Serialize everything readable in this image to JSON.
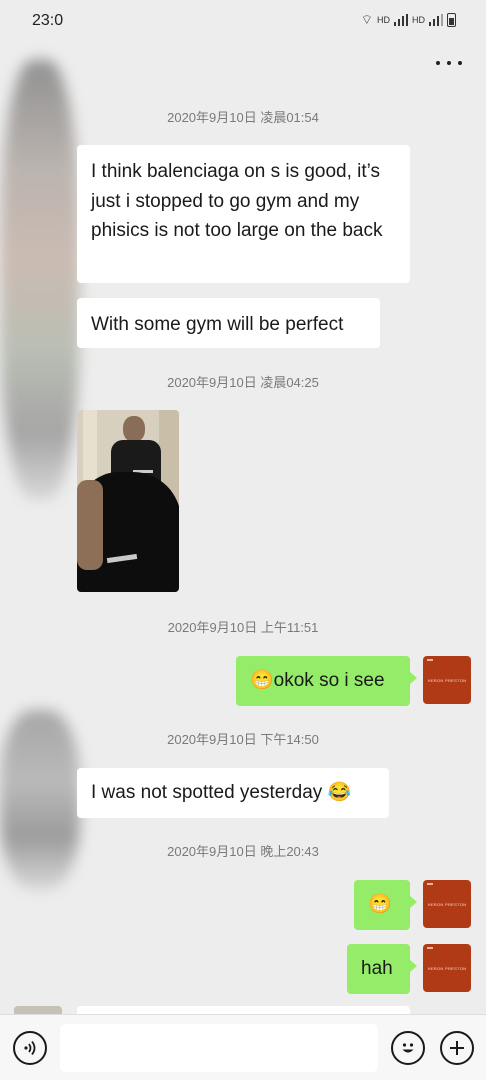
{
  "status_bar": {
    "time": "23:0",
    "network1": "HD",
    "network2": "HD"
  },
  "header": {
    "more_icon": "more-dots-icon"
  },
  "messages": {
    "ts1": "2020年9月10日 凌晨01:54",
    "m1": "I think balenciaga on s is good, it’s just i stopped to go gym and my phisics is not too large on the back",
    "m2": "With some gym will be perfect",
    "ts2": "2020年9月10日 凌晨04:25",
    "photo_icon": "photo-thumbnail",
    "ts3": "2020年9月10日 上午11:51",
    "m3": "😁okok so i see",
    "ts4": "2020年9月10日 下午14:50",
    "m4": "I was not spotted yesterday 😂",
    "ts5": "2020年9月10日 晚上20:43",
    "m5": "😁",
    "m6": "hah"
  },
  "avatar": {
    "text": "HERON PRESTON"
  },
  "input_bar": {
    "voice_icon": "voice-icon",
    "emoji_icon": "emoji-icon",
    "plus_icon": "plus-icon",
    "input_placeholder": ""
  },
  "colors": {
    "background": "#ededed",
    "incoming_bubble": "#ffffff",
    "outgoing_bubble": "#95ec69",
    "avatar": "#b03a16"
  }
}
